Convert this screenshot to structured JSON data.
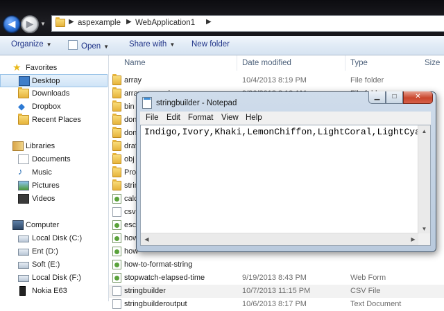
{
  "address": {
    "crumbs": [
      "aspexample",
      "WebApplication1"
    ]
  },
  "toolbar": {
    "organize": "Organize",
    "open": "Open",
    "share_with": "Share with",
    "new_folder": "New folder"
  },
  "nav": {
    "favorites": "Favorites",
    "desktop": "Desktop",
    "downloads": "Downloads",
    "dropbox": "Dropbox",
    "recent_places": "Recent Places",
    "libraries": "Libraries",
    "documents": "Documents",
    "music": "Music",
    "pictures": "Pictures",
    "videos": "Videos",
    "computer": "Computer",
    "local_c": "Local Disk (C:)",
    "ent_d": "Ent (D:)",
    "soft_e": "Soft (E:)",
    "local_f": "Local Disk (F:)",
    "nokia": "Nokia E63"
  },
  "list": {
    "columns": {
      "name": "Name",
      "date_modified": "Date modified",
      "type": "Type",
      "size": "Size"
    },
    "rows": [
      {
        "name": "array",
        "date": "10/4/2013 8:19 PM",
        "type": "File folder",
        "icon": "folder-icon"
      },
      {
        "name": "arrayconversion",
        "date": "9/26/2013 8:19 AM",
        "type": "File folder",
        "icon": "folder-icon"
      },
      {
        "name": "bin",
        "date": "",
        "type": "",
        "icon": "folder-icon"
      },
      {
        "name": "don",
        "date": "",
        "type": "",
        "icon": "folder-icon"
      },
      {
        "name": "don",
        "date": "",
        "type": "",
        "icon": "folder-icon"
      },
      {
        "name": "draf",
        "date": "",
        "type": "",
        "icon": "folder-icon"
      },
      {
        "name": "obj",
        "date": "",
        "type": "",
        "icon": "folder-icon"
      },
      {
        "name": "Prop",
        "date": "",
        "type": "",
        "icon": "folder-icon"
      },
      {
        "name": "strin",
        "date": "",
        "type": "",
        "icon": "folder-icon"
      },
      {
        "name": "calc",
        "date": "",
        "type": "",
        "icon": "web-form-icon"
      },
      {
        "name": "csv",
        "date": "",
        "type": "",
        "icon": "document-icon"
      },
      {
        "name": "esca",
        "date": "",
        "type": "",
        "icon": "web-form-icon"
      },
      {
        "name": "how",
        "date": "",
        "type": "",
        "icon": "web-form-icon"
      },
      {
        "name": "how",
        "date": "",
        "type": "",
        "icon": "web-form-icon"
      },
      {
        "name": "how-to-format-string",
        "date": "",
        "type": "",
        "icon": "web-form-icon"
      },
      {
        "name": "stopwatch-elapsed-time",
        "date": "9/19/2013 8:43 PM",
        "type": "Web Form",
        "icon": "web-form-icon"
      },
      {
        "name": "stringbuilder",
        "date": "10/7/2013 11:15 PM",
        "type": "CSV File",
        "icon": "document-icon"
      },
      {
        "name": "stringbuilderoutput",
        "date": "10/6/2013 8:17 PM",
        "type": "Text Document",
        "icon": "document-icon"
      }
    ]
  },
  "notepad": {
    "title": "stringbuilder - Notepad",
    "menu": [
      "File",
      "Edit",
      "Format",
      "View",
      "Help"
    ],
    "content": "Indigo,Ivory,Khaki,LemonChiffon,LightCoral,LightCyan"
  },
  "colors": {
    "address_bg": "#15151a",
    "toolbar_link": "#1e3287",
    "selection": "#cfe4f7"
  }
}
